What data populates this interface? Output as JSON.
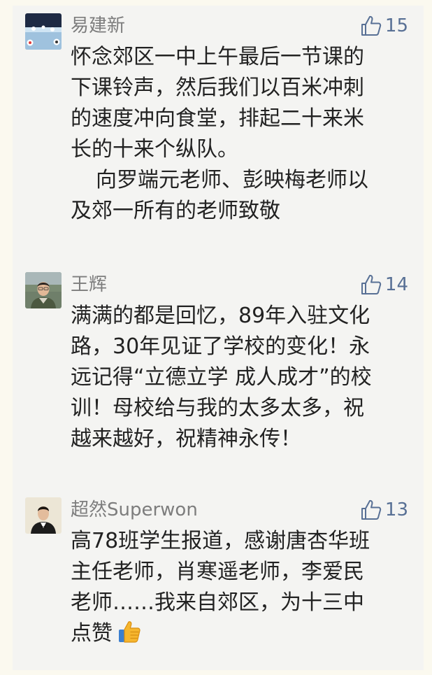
{
  "comments": [
    {
      "user": "易建新",
      "likes": "15",
      "lines": [
        "怀念郊区一中上午最后一节课的",
        "下课铃声，然后我们以百米冲刺",
        "的速度冲向食堂，排起二十来米",
        "长的十来个纵队。",
        "向罗端元老师、彭映梅老师以",
        "及郊一所有的老师致敬"
      ]
    },
    {
      "user": "王辉",
      "likes": "14",
      "lines": [
        "满满的都是回忆，89年入驻文化",
        "路，30年见证了学校的变化！永",
        "远记得“立德立学 成人成才”的校",
        "训！母校给与我的太多太多，祝",
        "越来越好，祝精神永传！"
      ]
    },
    {
      "user": "超然Superwon",
      "likes": "13",
      "lines": [
        "高78班学生报道，感谢唐杏华班",
        "主任老师，肖寒遥老师，李爱民",
        "老师……我来自郊区，为十三中",
        "点赞"
      ]
    }
  ],
  "colors": {
    "page_bg": "#fbf9ef",
    "panel_bg": "#f4f4f2",
    "name": "#7d7d7d",
    "like": "#587095",
    "text": "#222222"
  },
  "icons": {
    "like": "thumbs-up-outline-icon",
    "emoji": "thumbs-up-emoji"
  }
}
